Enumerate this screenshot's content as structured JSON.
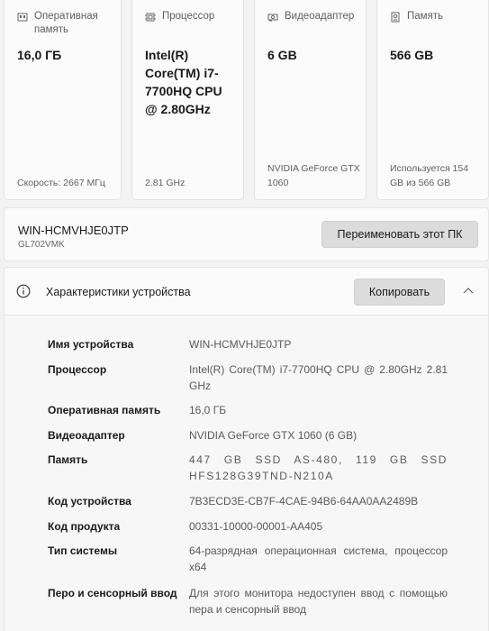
{
  "cards": [
    {
      "icon": "ram-icon",
      "title": "Оперативная память",
      "value": "16,0 ГБ",
      "footer": "Скорость: 2667 МГц"
    },
    {
      "icon": "processor-icon",
      "title": "Процессор",
      "value": "Intel(R) Core(TM) i7-7700HQ CPU @ 2.80GHz",
      "footer": "2.81 GHz"
    },
    {
      "icon": "gpu-icon",
      "title": "Видеоадаптер",
      "value": "6 GB",
      "footer": "NVIDIA GeForce GTX 1060"
    },
    {
      "icon": "storage-icon",
      "title": "Память",
      "value": "566 GB",
      "footer": "Используется 154 GB из 566 GB"
    }
  ],
  "device": {
    "name": "WIN-HCMVHJE0JTP",
    "model": "GL702VMK",
    "rename_label": "Переименовать этот ПК"
  },
  "specs": {
    "title": "Характеристики устройства",
    "copy_label": "Копировать",
    "rows": [
      {
        "label": "Имя устройства",
        "value": "WIN-HCMVHJE0JTP"
      },
      {
        "label": "Процессор",
        "value": "Intel(R) Core(TM) i7-7700HQ CPU @ 2.80GHz 2.81 GHz"
      },
      {
        "label": "Оперативная память",
        "value": "16,0 ГБ"
      },
      {
        "label": "Видеоадаптер",
        "value": "NVIDIA GeForce GTX 1060 (6 GB)"
      },
      {
        "label": "Память",
        "value": "447 GB SSD AS-480, 119 GB SSD HFS128G39TND-N210A"
      },
      {
        "label": "Код устройства",
        "value": "7B3ECD3E-CB7F-4CAE-94B6-64AA0AA2489B"
      },
      {
        "label": "Код продукта",
        "value": "00331-10000-00001-AA405"
      },
      {
        "label": "Тип системы",
        "value": "64-разрядная операционная система, процессор x64"
      },
      {
        "label": "Перо и сенсорный ввод",
        "value": "Для этого монитора недоступен ввод с помощью пера и сенсорный ввод"
      }
    ]
  }
}
